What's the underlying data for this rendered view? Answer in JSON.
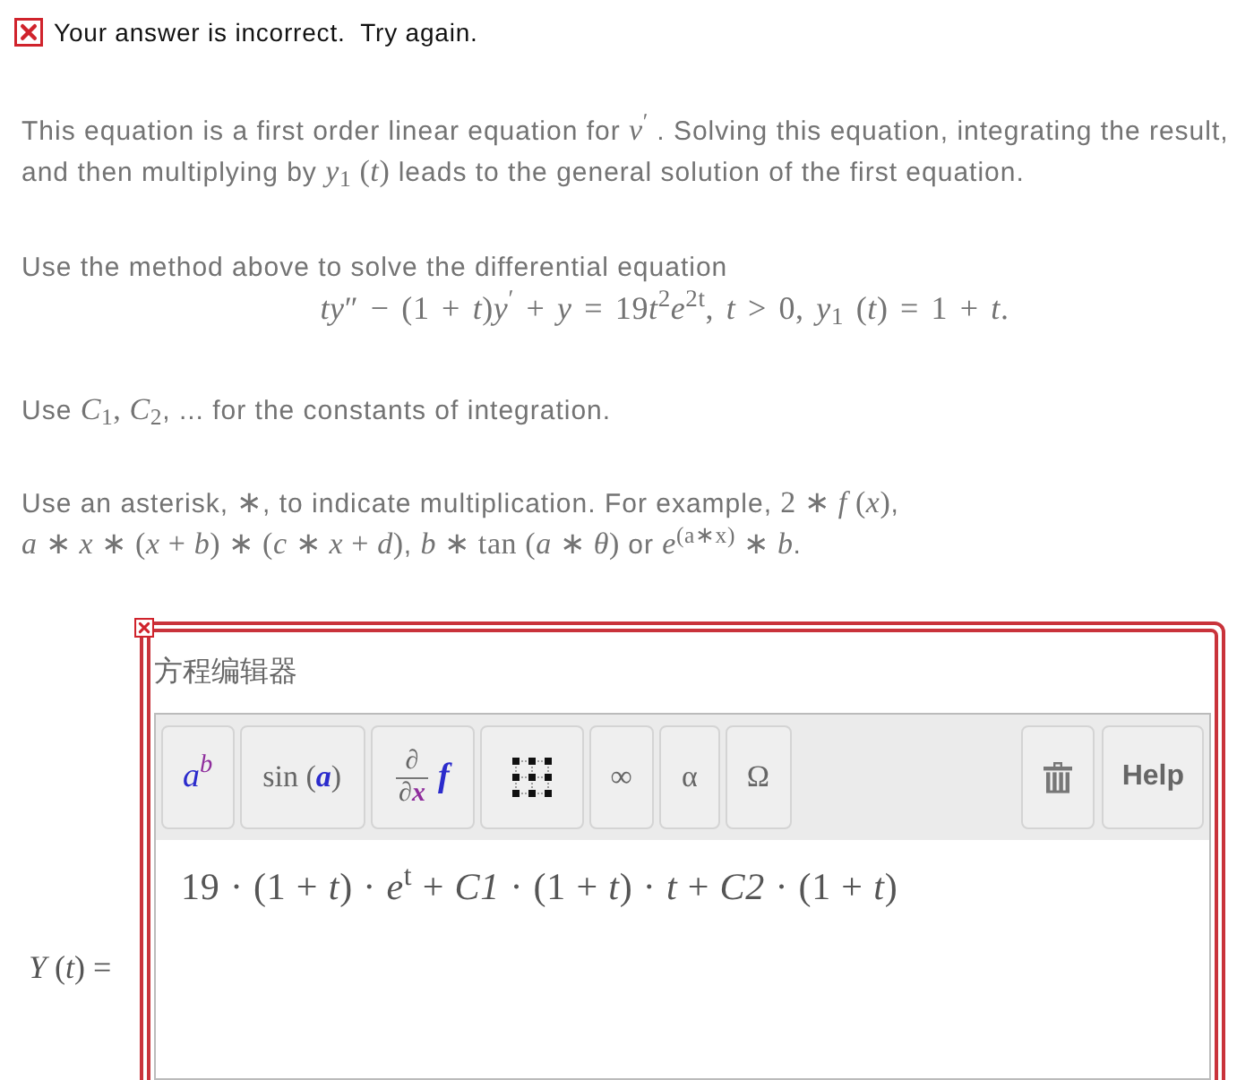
{
  "feedback": {
    "correct": false,
    "message": "Your answer is incorrect.  Try again."
  },
  "instructions": [
    {
      "segments": [
        {
          "kind": "text",
          "text": "This equation is a first order linear equation for "
        },
        {
          "kind": "math",
          "text": "*v*$^{′}$"
        },
        {
          "kind": "text",
          "text": " . Solving this equation, integrating the result, and then multiplying by "
        },
        {
          "kind": "math",
          "text": "*y*$_{1}$ (*t*)"
        },
        {
          "kind": "text",
          "text": " leads to the general solution of the first equation."
        }
      ]
    },
    {
      "segments": [
        {
          "kind": "text",
          "text": "Use the method above to solve the differential equation"
        }
      ],
      "display_math": [
        "*ty*″ − (1 + *t*)*y*$^{′}$ + *y* = 19",
        "*t*$^{2}$*e*$^{2t}$, *t* > 0, *y*$_{1}$ (*t*) = 1 + *t*."
      ]
    },
    {
      "segments": [
        {
          "kind": "text",
          "text": "Use "
        },
        {
          "kind": "math",
          "text": "*C*$_{1}$, *C*$_{2}$"
        },
        {
          "kind": "text",
          "text": ", ... for the constants of integration."
        }
      ]
    },
    {
      "segments": [
        {
          "kind": "text",
          "text": "Use an asterisk, "
        },
        {
          "kind": "math",
          "text": "∗"
        },
        {
          "kind": "text",
          "text": ", to indicate multiplication. For example, "
        },
        {
          "kind": "math",
          "text": "2 ∗ *f* (*x*)"
        },
        {
          "kind": "text",
          "text": ", "
        },
        {
          "kind": "math",
          "text": "*a* ∗ *x* ∗ (*x* + *b*) ∗ (*c* ∗ *x* + *d*)"
        },
        {
          "kind": "text",
          "text": ", "
        },
        {
          "kind": "math",
          "text": "*b* ∗ tan (*a* ∗ *θ*)"
        },
        {
          "kind": "text",
          "text": " or "
        },
        {
          "kind": "math",
          "text": "*e*$^{(a∗x)}$ ∗ *b*"
        },
        {
          "kind": "text",
          "text": "."
        }
      ]
    }
  ],
  "equation_editor": {
    "title": "方程编辑器",
    "correct": false,
    "toolbar": {
      "left_buttons": [
        {
          "kind": "power",
          "label": "*a*$^{b}$"
        },
        {
          "kind": "function",
          "label": "sin (*a*)"
        },
        {
          "kind": "derivative",
          "numerator": "∂",
          "denominator": "∂*x*",
          "operand": "*f*"
        },
        {
          "kind": "matrix"
        },
        {
          "kind": "symbol",
          "label": "∞"
        },
        {
          "kind": "symbol",
          "label": "α"
        },
        {
          "kind": "symbol",
          "label": "Ω"
        }
      ],
      "right_buttons": [
        {
          "kind": "trash"
        },
        {
          "kind": "text",
          "label": "Help"
        }
      ]
    },
    "answer_label": "*Y* (*t*) =",
    "answer_field": {
      "value": "19 · (1 + *t*) · *e*$^{t}$ + *C1* · (1 + *t*) · *t* + *C2* · (1 + *t*)"
    }
  }
}
